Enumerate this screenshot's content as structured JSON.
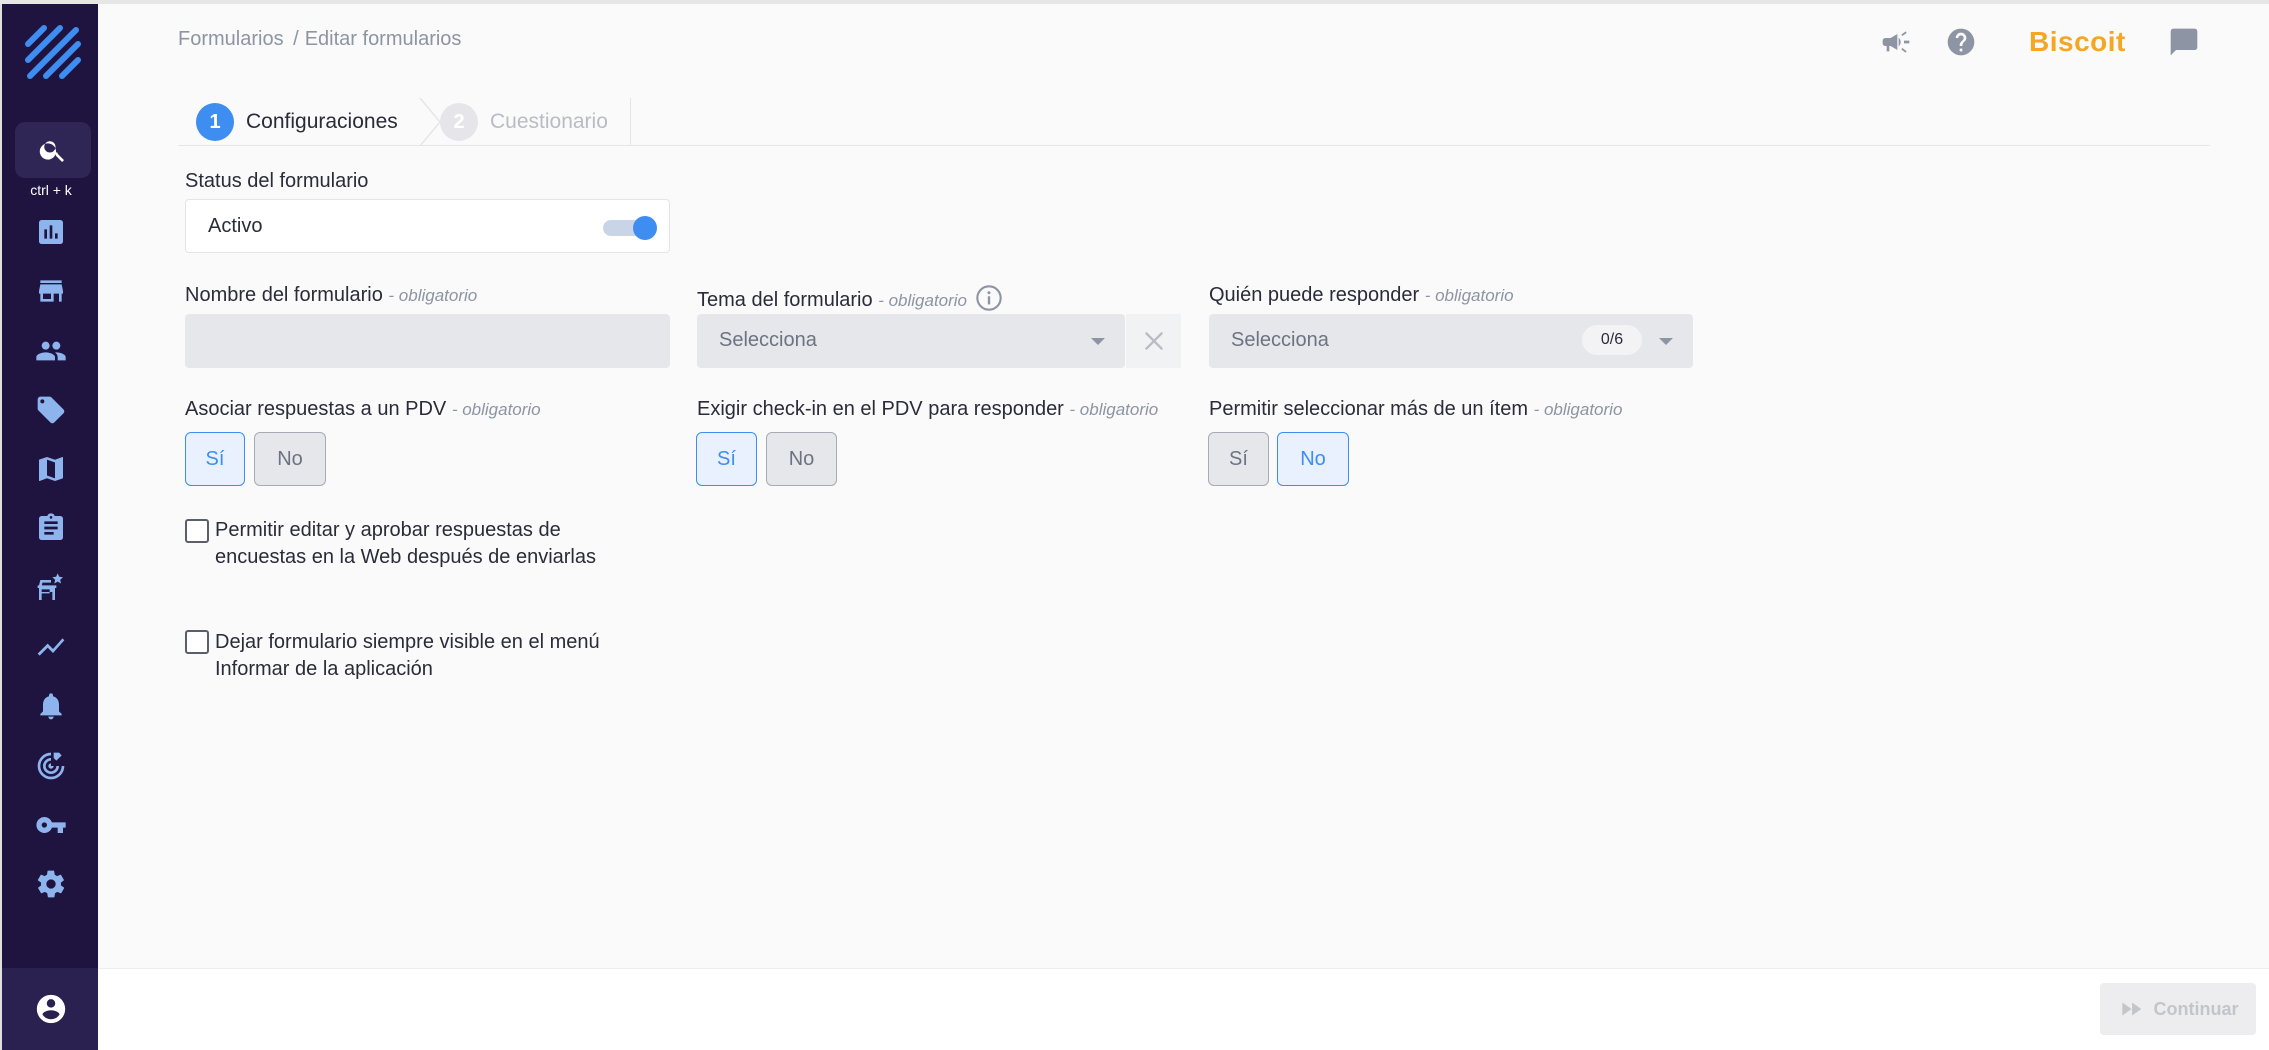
{
  "breadcrumb": {
    "parent": "Formularios",
    "separator": "/",
    "current": "Editar formularios"
  },
  "sidebar": {
    "shortcut": "ctrl + k",
    "items": [
      {
        "icon": "chart-icon"
      },
      {
        "icon": "store-icon"
      },
      {
        "icon": "people-icon"
      },
      {
        "icon": "tag-icon"
      },
      {
        "icon": "map-icon"
      },
      {
        "icon": "clipboard-icon"
      },
      {
        "icon": "store-star-icon"
      },
      {
        "icon": "trend-icon"
      },
      {
        "icon": "bell-icon"
      },
      {
        "icon": "target-icon"
      },
      {
        "icon": "key-icon"
      },
      {
        "icon": "gear-icon"
      }
    ]
  },
  "header": {
    "brand": "Biscoit"
  },
  "stepper": {
    "steps": [
      {
        "number": "1",
        "label": "Configuraciones"
      },
      {
        "number": "2",
        "label": "Cuestionario"
      }
    ]
  },
  "form": {
    "status": {
      "label": "Status del formulario",
      "value": "Activo",
      "enabled": true
    },
    "required_tag": "- obligatorio",
    "name": {
      "label": "Nombre del formulario",
      "value": ""
    },
    "theme": {
      "label": "Tema del formulario",
      "placeholder": "Selecciona"
    },
    "who": {
      "label": "Quién puede responder",
      "placeholder": "Selecciona",
      "count": "0/6"
    },
    "associate": {
      "label": "Asociar respuestas a un PDV",
      "yes": "Sí",
      "no": "No",
      "selected": "yes"
    },
    "checkin": {
      "label": "Exigir check-in en el PDV para responder",
      "yes": "Sí",
      "no": "No",
      "selected": "yes"
    },
    "multi": {
      "label": "Permitir seleccionar más de un ítem",
      "yes": "Sí",
      "no": "No",
      "selected": "no"
    },
    "checkbox1": {
      "line1": "Permitir editar y aprobar respuestas de",
      "line2": "encuestas en la Web después de enviarlas",
      "checked": false
    },
    "checkbox2": {
      "line1": "Dejar formulario siempre visible en el menú",
      "line2": "Informar de la aplicación",
      "checked": false
    }
  },
  "footer": {
    "continue": "Continuar"
  },
  "colors": {
    "accent": "#3d8ef0",
    "sidebar": "#1f1440",
    "brand": "#f5a623"
  }
}
